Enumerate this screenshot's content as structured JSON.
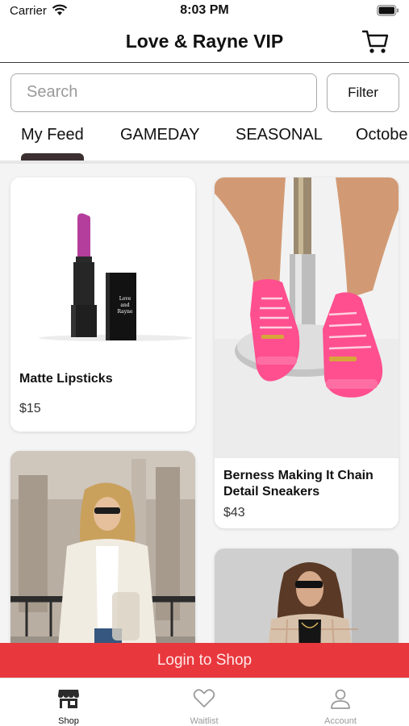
{
  "status_bar": {
    "carrier": "Carrier",
    "time": "8:03 PM"
  },
  "header": {
    "title": "Love & Rayne VIP"
  },
  "search": {
    "placeholder": "Search",
    "filter_label": "Filter"
  },
  "categories": [
    "My Feed",
    "GAMEDAY",
    "SEASONAL",
    "Octobe"
  ],
  "products": [
    {
      "title": "Matte Lipsticks",
      "price": "$15",
      "box_text": [
        "Love",
        "and",
        "Rayne"
      ]
    },
    {
      "title": "Berness Making It Chain Detail Sneakers",
      "price": "$43"
    }
  ],
  "login_banner": {
    "label": "Login to Shop"
  },
  "tab_bar": {
    "items": [
      {
        "label": "Shop"
      },
      {
        "label": "Waitlist"
      },
      {
        "label": "Account"
      }
    ]
  },
  "colors": {
    "accent": "#e8383d",
    "tab_indicator": "#3b2f2f",
    "sneaker_pink": "#ff4f8f"
  }
}
